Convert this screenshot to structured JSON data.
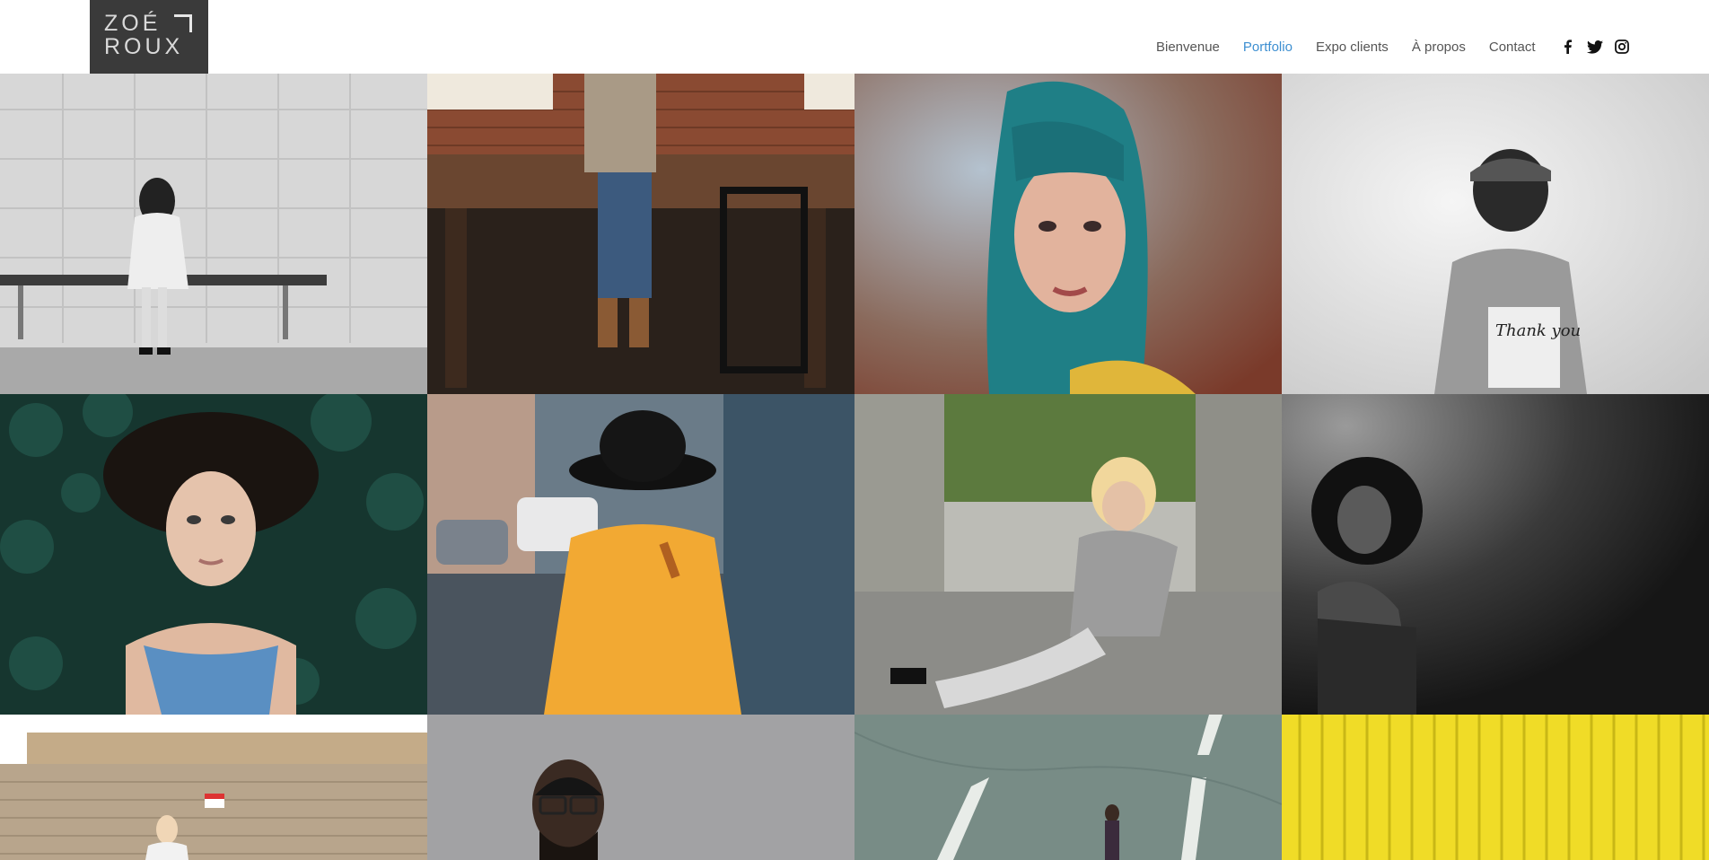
{
  "logo": {
    "line1": "ZOÉ",
    "line2": "ROUX"
  },
  "nav": {
    "items": [
      {
        "label": "Bienvenue",
        "active": false
      },
      {
        "label": "Portfolio",
        "active": true
      },
      {
        "label": "Expo clients",
        "active": false
      },
      {
        "label": "À propos",
        "active": false
      },
      {
        "label": "Contact",
        "active": false
      }
    ],
    "active_color": "#3d8fd1"
  },
  "social": [
    "facebook-icon",
    "twitter-icon",
    "instagram-icon"
  ],
  "gallery": {
    "tiles": [
      {
        "name": "photo-woman-bench"
      },
      {
        "name": "photo-person-table"
      },
      {
        "name": "photo-teal-hair"
      },
      {
        "name": "photo-boy-cap"
      },
      {
        "name": "photo-woman-leaves"
      },
      {
        "name": "photo-yellow-coat"
      },
      {
        "name": "photo-tattoo-woman"
      },
      {
        "name": "photo-curly-hair"
      },
      {
        "name": "photo-woman-wall"
      },
      {
        "name": "photo-man-glasses"
      },
      {
        "name": "photo-road"
      },
      {
        "name": "photo-yellow-wall"
      }
    ],
    "thank_you_shirt": "Thank you"
  }
}
